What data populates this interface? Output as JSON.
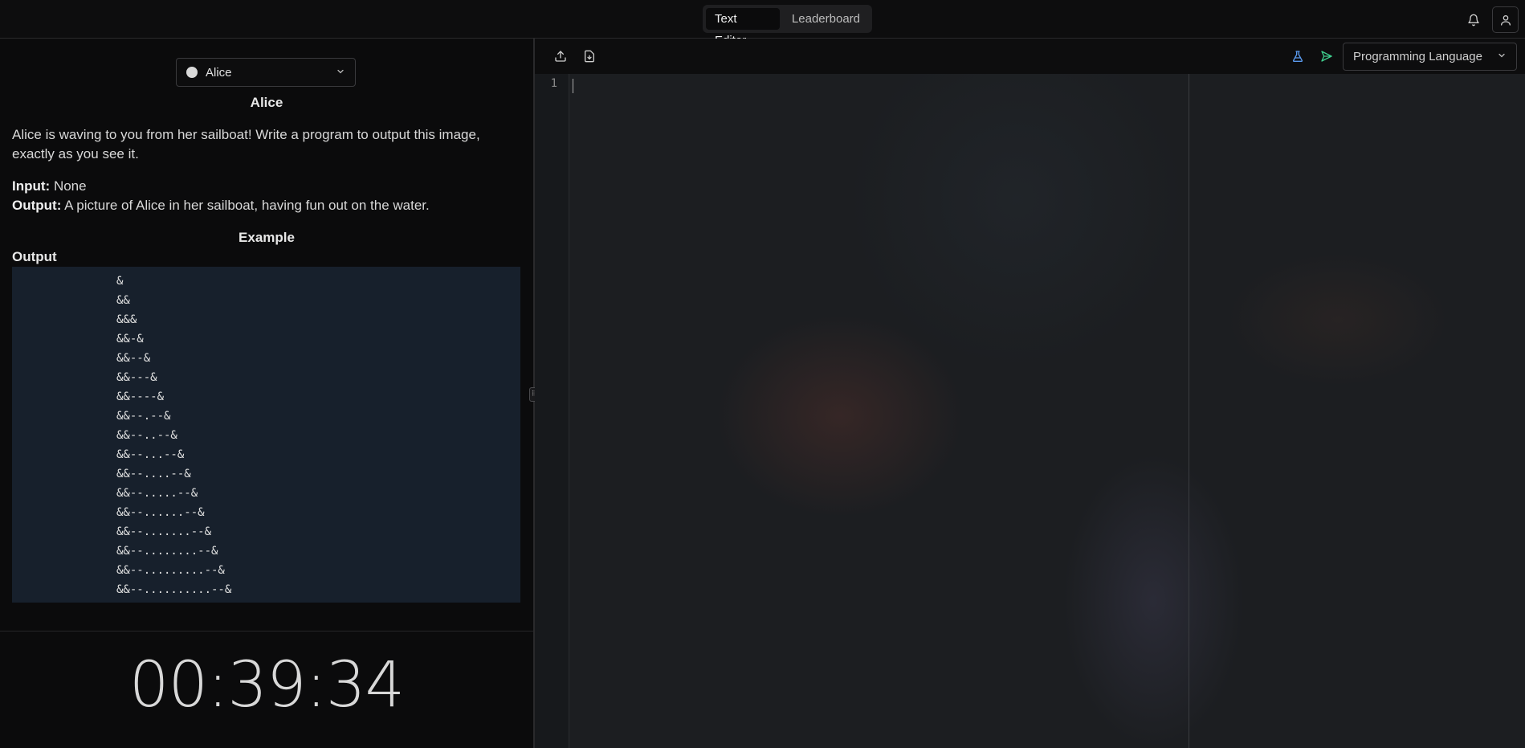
{
  "header": {
    "tabs": [
      {
        "label": "Text Editor",
        "active": true
      },
      {
        "label": "Leaderboard",
        "active": false
      }
    ],
    "icons": [
      "bell-icon",
      "user-icon"
    ]
  },
  "problem": {
    "selector": {
      "value": "Alice",
      "dot_color": "#d9d9d9"
    },
    "title": "Alice",
    "description": "Alice is waving to you from her sailboat! Write a program to output this image, exactly as you see it.",
    "input_label": "Input:",
    "input_value": "None",
    "output_label": "Output:",
    "output_value": "A picture of Alice in her sailboat, having fun out on the water.",
    "example_title": "Example",
    "example_output_label": "Output",
    "example_output_lines": [
      "&",
      "&&",
      "&&&",
      "&&-&",
      "&&--&",
      "&&---&",
      "&&----&",
      "&&--.--&",
      "&&--..--&",
      "&&--...--&",
      "&&--....--&",
      "&&--.....--&",
      "&&--......--&",
      "&&--.......--&",
      "&&--........--&",
      "&&--.........--&",
      "&&--..........--&"
    ]
  },
  "timer": {
    "value": "00:39:34"
  },
  "editor": {
    "language_placeholder": "Programming Language",
    "line_numbers": [
      "1"
    ],
    "toolbar_icons": [
      "upload-icon",
      "import-file-icon",
      "test-flask-icon",
      "submit-send-icon"
    ],
    "accent_colors": {
      "flask": "#5b9bf0",
      "send": "#3fcf8e"
    }
  }
}
